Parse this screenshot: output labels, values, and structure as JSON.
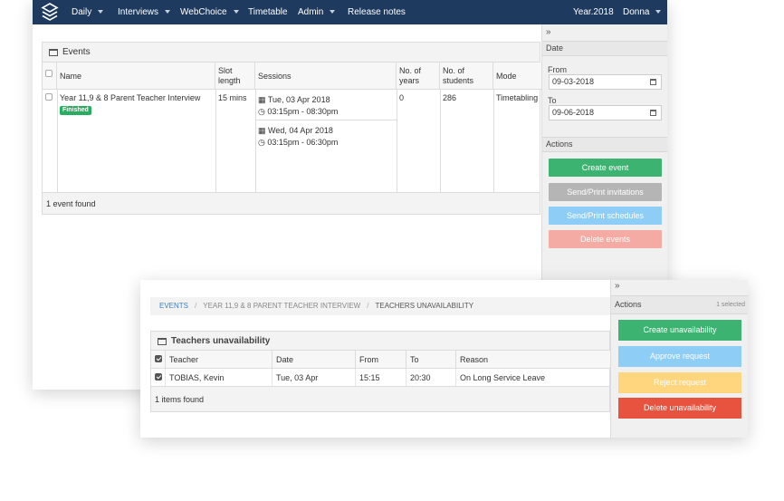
{
  "navbar": {
    "items": [
      "Daily",
      "Interviews",
      "WebChoice",
      "Timetable",
      "Admin",
      "Release notes"
    ],
    "year": "Year.2018",
    "user": "Donna"
  },
  "events": {
    "title": "Events",
    "columns": [
      "Name",
      "Slot length",
      "Sessions",
      "No. of years",
      "No. of students",
      "Mode"
    ],
    "row": {
      "name": "Year 11,9 & 8 Parent Teacher Interview",
      "status": "Finished",
      "slot_length": "15 mins",
      "sessions": [
        {
          "date": "Tue, 03 Apr 2018",
          "time": "03:15pm - 08:30pm"
        },
        {
          "date": "Wed, 04 Apr 2018",
          "time": "03:15pm - 06:30pm"
        }
      ],
      "years": "0",
      "students": "286",
      "mode": "Timetabling"
    },
    "footer": "1 event found"
  },
  "sidebar": {
    "toggle": "»",
    "date_section": "Date",
    "from_label": "From",
    "from_value": "09-03-2018",
    "to_label": "To",
    "to_value": "09-06-2018",
    "actions_section": "Actions",
    "buttons": {
      "create": "Create event",
      "send_invites": "Send/Print invitations",
      "send_schedules": "Send/Print schedules",
      "delete": "Delete events"
    }
  },
  "unavailability": {
    "breadcrumb": [
      "EVENTS",
      "YEAR 11,9 & 8 PARENT TEACHER INTERVIEW",
      "TEACHERS UNAVAILABILITY"
    ],
    "title": "Teachers unavailability",
    "columns": [
      "Teacher",
      "Date",
      "From",
      "To",
      "Reason"
    ],
    "row": {
      "teacher": "TOBIAS, Kevin",
      "date": "Tue, 03 Apr",
      "from": "15:15",
      "to": "20:30",
      "reason": "On Long Service Leave"
    },
    "footer": "1 items found"
  },
  "front_sidebar": {
    "toggle": "»",
    "actions": "Actions",
    "selected": "1 selected",
    "buttons": {
      "create": "Create unavailability",
      "approve": "Approve request",
      "reject": "Reject request",
      "delete": "Delete unavailability"
    }
  },
  "colors": {
    "navbar": "#1e3a5f",
    "green": "#3cb371",
    "grey": "#b5b5b5",
    "blue_light": "#8ecdf5",
    "salmon": "#f3aba4",
    "yellow": "#ffd57e",
    "red": "#e8533f",
    "link": "#3a7fc1"
  }
}
